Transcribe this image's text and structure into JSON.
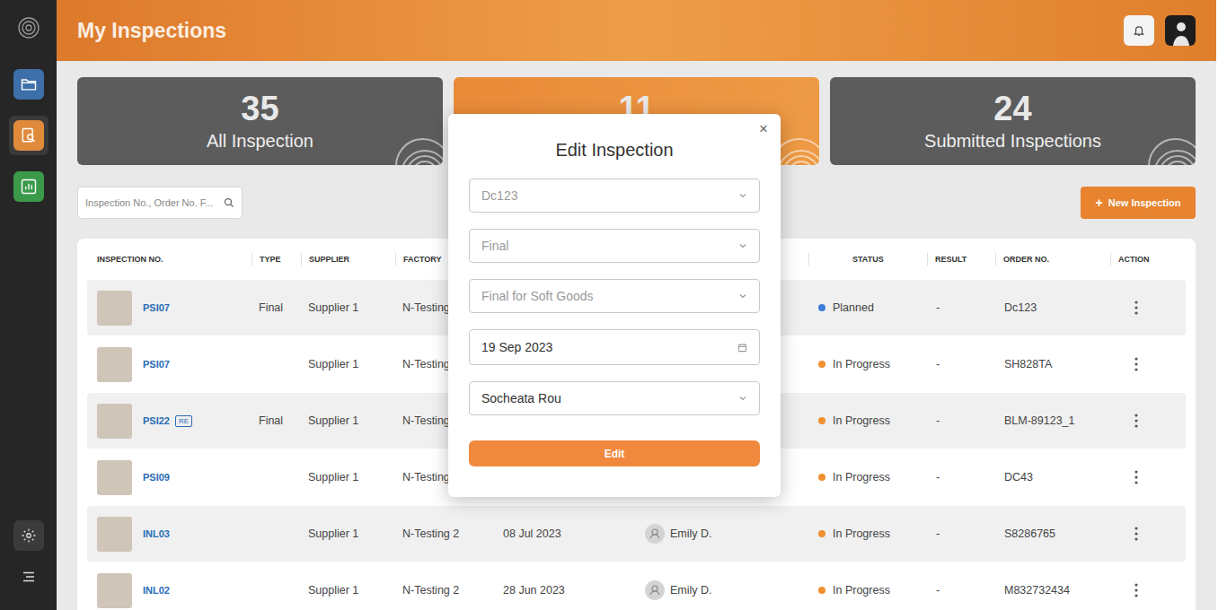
{
  "sidebar": {
    "items": [
      {
        "selected": false,
        "color": "#3d6fa8"
      },
      {
        "selected": true,
        "color": "#e08a3c"
      },
      {
        "selected": false,
        "color": "#3a9a4a"
      }
    ]
  },
  "header": {
    "title": "My Inspections"
  },
  "summary_cards": [
    {
      "count": "35",
      "label": "All Inspection",
      "selected": false
    },
    {
      "count": "11",
      "label": "",
      "selected": true
    },
    {
      "count": "24",
      "label": "Submitted Inspections",
      "selected": false
    }
  ],
  "search": {
    "placeholder": "Inspection No., Order No. F..."
  },
  "new_button": {
    "icon": "+",
    "label": "New Inspection"
  },
  "table": {
    "columns": [
      "INSPECTION NO.",
      "TYPE",
      "SUPPLIER",
      "FACTORY",
      "",
      "",
      "STATUS",
      "RESULT",
      "ORDER NO.",
      "ACTION"
    ],
    "rows": [
      {
        "inspection_no": "PSI07",
        "badge": "",
        "type": "Final",
        "supplier": "Supplier 1",
        "factory": "N-Testing",
        "date": "",
        "inspector": "",
        "status": "Planned",
        "status_color": "#3b7dd8",
        "result": "-",
        "order_no": "Dc123"
      },
      {
        "inspection_no": "PSI07",
        "badge": "",
        "type": "",
        "supplier": "Supplier 1",
        "factory": "N-Testing",
        "date": "",
        "inspector": "",
        "status": "In Progress",
        "status_color": "#f0902f",
        "result": "-",
        "order_no": "SH828TA"
      },
      {
        "inspection_no": "PSI22",
        "badge": "RE",
        "type": "Final",
        "supplier": "Supplier 1",
        "factory": "N-Testing",
        "date": "",
        "inspector": "",
        "status": "In Progress",
        "status_color": "#f0902f",
        "result": "-",
        "order_no": "BLM-89123_1"
      },
      {
        "inspection_no": "PSI09",
        "badge": "",
        "type": "",
        "supplier": "Supplier 1",
        "factory": "N-Testing",
        "date": "",
        "inspector": "",
        "status": "In Progress",
        "status_color": "#f0902f",
        "result": "-",
        "order_no": "DC43"
      },
      {
        "inspection_no": "INL03",
        "badge": "",
        "type": "",
        "supplier": "Supplier 1",
        "factory": "N-Testing 2",
        "date": "08 Jul 2023",
        "inspector": "Emily D.",
        "status": "In Progress",
        "status_color": "#f0902f",
        "result": "-",
        "order_no": "S8286765"
      },
      {
        "inspection_no": "INL02",
        "badge": "",
        "type": "",
        "supplier": "Supplier 1",
        "factory": "N-Testing 2",
        "date": "28 Jun 2023",
        "inspector": "Emily D.",
        "status": "In Progress",
        "status_color": "#f0902f",
        "result": "-",
        "order_no": "M832732434"
      }
    ]
  },
  "modal": {
    "title": "Edit Inspection",
    "close": "×",
    "fields": [
      {
        "value": "Dc123",
        "kind": "select",
        "disabled": true
      },
      {
        "value": "Final",
        "kind": "select",
        "disabled": true
      },
      {
        "value": "Final for Soft Goods",
        "kind": "select",
        "disabled": true
      },
      {
        "value": "19 Sep 2023",
        "kind": "date",
        "disabled": false
      },
      {
        "value": "Socheata Rou",
        "kind": "select",
        "disabled": false
      }
    ],
    "button": "Edit"
  }
}
